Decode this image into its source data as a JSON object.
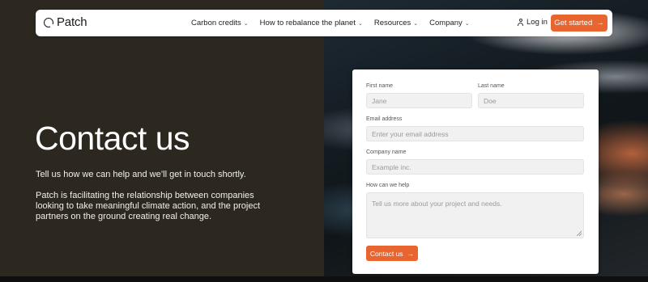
{
  "nav": {
    "brand": "Patch",
    "menu": [
      {
        "label": "Carbon credits"
      },
      {
        "label": "How to rebalance the planet"
      },
      {
        "label": "Resources"
      },
      {
        "label": "Company"
      }
    ],
    "login": "Log in",
    "cta": "Get started",
    "accent": "#e8652f"
  },
  "hero": {
    "title": "Contact us",
    "subtitle": "Tell us how we can help and we’ll get in touch shortly.",
    "body": "Patch is facilitating the relationship between companies looking to take meaningful climate action, and the project partners on the ground creating real change."
  },
  "form": {
    "first_name": {
      "label": "First name",
      "placeholder": "Jane"
    },
    "last_name": {
      "label": "Last name",
      "placeholder": "Doe"
    },
    "email": {
      "label": "Email address",
      "placeholder": "Enter your email address"
    },
    "company": {
      "label": "Company name",
      "placeholder": "Example inc."
    },
    "help": {
      "label": "How can we help",
      "placeholder": "Tell us more about your project and needs."
    },
    "submit": "Contact us"
  }
}
